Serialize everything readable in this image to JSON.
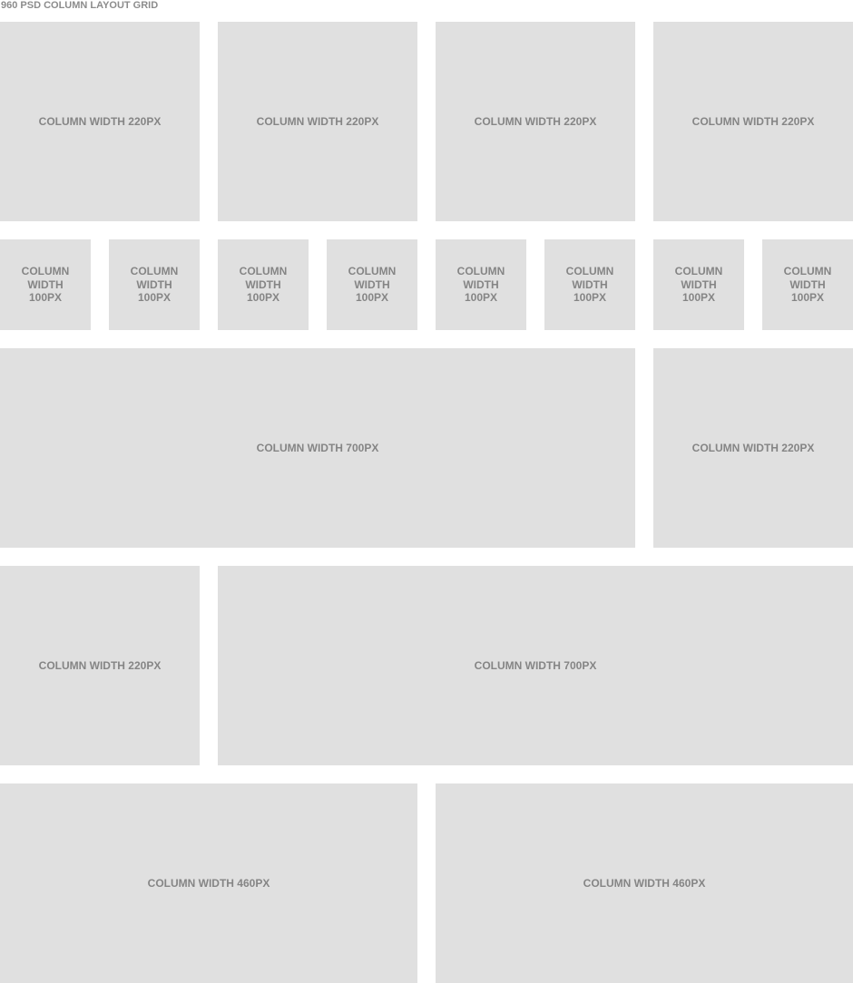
{
  "title": "960 PSD COLUMN LAYOUT GRID",
  "grid_color": "#e0e0e0",
  "label_color": "#858585",
  "rows": [
    {
      "columns": [
        {
          "label": "COLUMN WIDTH 220PX"
        },
        {
          "label": "COLUMN WIDTH 220PX"
        },
        {
          "label": "COLUMN WIDTH 220PX"
        },
        {
          "label": "COLUMN WIDTH 220PX"
        }
      ]
    },
    {
      "columns": [
        {
          "label": "COLUMN WIDTH 100PX"
        },
        {
          "label": "COLUMN WIDTH 100PX"
        },
        {
          "label": "COLUMN WIDTH 100PX"
        },
        {
          "label": "COLUMN WIDTH 100PX"
        },
        {
          "label": "COLUMN WIDTH 100PX"
        },
        {
          "label": "COLUMN WIDTH 100PX"
        },
        {
          "label": "COLUMN WIDTH 100PX"
        },
        {
          "label": "COLUMN WIDTH 100PX"
        }
      ]
    },
    {
      "columns": [
        {
          "label": "COLUMN WIDTH 700PX"
        },
        {
          "label": "COLUMN WIDTH 220PX"
        }
      ]
    },
    {
      "columns": [
        {
          "label": "COLUMN WIDTH 220PX"
        },
        {
          "label": "COLUMN WIDTH 700PX"
        }
      ]
    },
    {
      "columns": [
        {
          "label": "COLUMN WIDTH 460PX"
        },
        {
          "label": "COLUMN WIDTH 460PX"
        }
      ]
    }
  ]
}
